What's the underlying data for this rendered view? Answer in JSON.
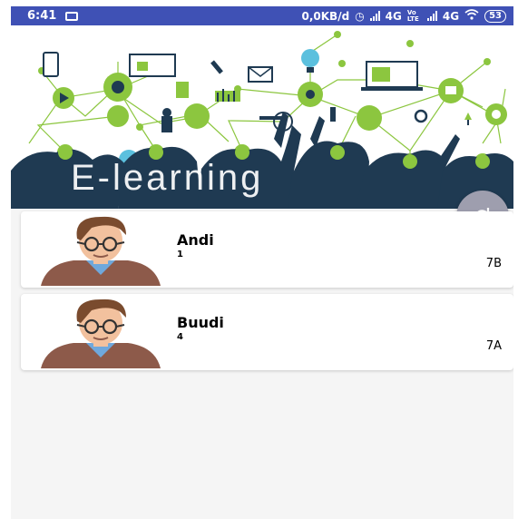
{
  "status_bar": {
    "time": "6:41",
    "network_speed": "0,0KB/d",
    "net1": "4G",
    "volte": "Vo LTE",
    "net2": "4G",
    "battery": "53"
  },
  "header": {
    "title": "E-learning"
  },
  "fab": {
    "icon": "refresh-icon"
  },
  "students": [
    {
      "name": "Andi",
      "number": "1",
      "class": "7B"
    },
    {
      "name": "Buudi",
      "number": "4",
      "class": "7A"
    }
  ],
  "colors": {
    "status_bar": "#3f51b5",
    "accent_green": "#8cc63f",
    "silhouette": "#1f3a52",
    "fab": "#9e9eae"
  }
}
